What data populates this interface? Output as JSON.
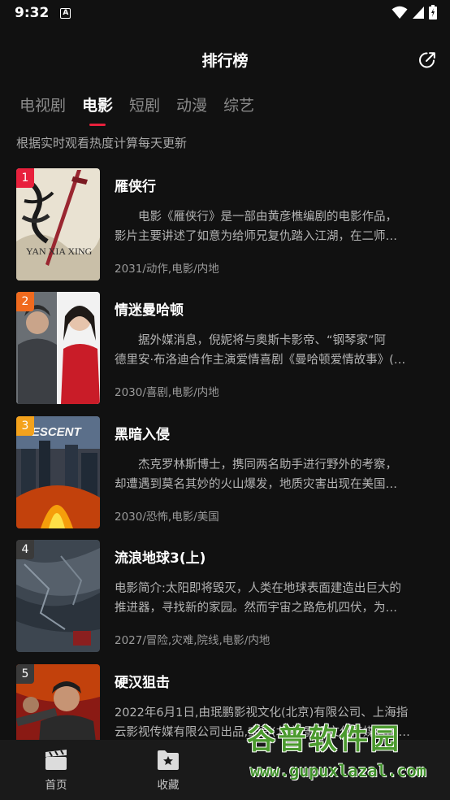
{
  "status_bar": {
    "time": "9:32",
    "notification_badge": "A"
  },
  "header": {
    "title": "排行榜"
  },
  "tabs": [
    {
      "label": "电视剧",
      "active": false
    },
    {
      "label": "电影",
      "active": true
    },
    {
      "label": "短剧",
      "active": false
    },
    {
      "label": "动漫",
      "active": false
    },
    {
      "label": "综艺",
      "active": false
    }
  ],
  "subtitle": "根据实时观看热度计算每天更新",
  "colors": {
    "accent": "#e8203c",
    "rank1": "#e8203c",
    "rank2": "#f06a1e",
    "rank3": "#f4a21c",
    "rank_default": "#3a3a3a"
  },
  "movies": [
    {
      "rank": "1",
      "title": "雁侠行",
      "desc_line1": "　　电影《雁侠行》是一部由黄彦樵编剧的电影作品，",
      "desc_line2": "影片主要讲述了如意为给师兄复仇踏入江湖，在二师…",
      "meta": "2031/动作,电影/内地",
      "poster_text": "YAN XIA XING"
    },
    {
      "rank": "2",
      "title": "情迷曼哈顿",
      "desc_line1": "　　据外媒消息，倪妮将与奥斯卡影帝、“钢琴家”阿",
      "desc_line2": "德里安·布洛迪合作主演爱情喜剧《曼哈顿爱情故事》(…",
      "meta": "2030/喜剧,电影/内地"
    },
    {
      "rank": "3",
      "title": "黑暗入侵",
      "desc_line1": "　　杰克罗林斯博士，携同两名助手进行野外的考察，",
      "desc_line2": "却遭遇到莫名其妙的火山爆发，地质灾害出现在美国…",
      "meta": "2030/恐怖,电影/美国",
      "poster_text": "DESCENT"
    },
    {
      "rank": "4",
      "title": "流浪地球3(上)",
      "desc_line1": "电影简介:太阳即将毁灭，人类在地球表面建造出巨大的",
      "desc_line2": "推进器，寻找新的家园。然而宇宙之路危机四伏，为…",
      "meta": "2027/冒险,灾难,院线,电影/内地"
    },
    {
      "rank": "5",
      "title": "硬汉狙击",
      "desc_line1": "2022年6月1日,由珉鹏影视文化(北京)有限公司、上海指",
      "desc_line2": "云影视传媒有限公司出品,宝哥(北京)影视文化传媒有限…",
      "meta": ""
    }
  ],
  "bottom_nav": [
    {
      "label": "首页",
      "icon": "clapperboard-icon"
    },
    {
      "label": "收藏",
      "icon": "bookmark-folder-icon"
    }
  ],
  "watermark": {
    "text": "谷普软件园",
    "url": "www.gupuxlazal.com"
  }
}
